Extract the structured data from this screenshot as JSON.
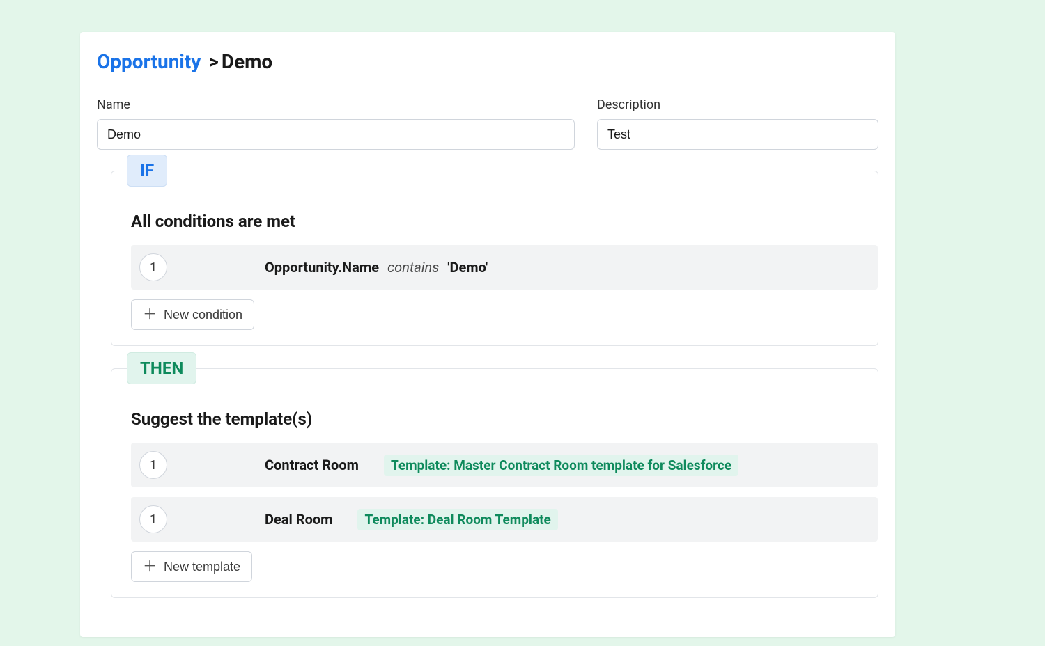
{
  "breadcrumb": {
    "parent": "Opportunity",
    "sep": ">",
    "current": "Demo"
  },
  "form": {
    "name_label": "Name",
    "name_value": "Demo",
    "desc_label": "Description",
    "desc_value": "Test"
  },
  "if": {
    "badge": "IF",
    "title": "All conditions are met",
    "conditions": [
      {
        "num": "1",
        "field": "Opportunity.Name",
        "op": "contains",
        "value": "'Demo'"
      }
    ],
    "add_label": "New condition"
  },
  "then": {
    "badge": "THEN",
    "title": "Suggest the template(s)",
    "templates": [
      {
        "num": "1",
        "type": "Contract Room",
        "chip": "Template: Master Contract Room template for Salesforce"
      },
      {
        "num": "1",
        "type": "Deal Room",
        "chip": "Template: Deal Room Template"
      }
    ],
    "add_label": "New template"
  }
}
